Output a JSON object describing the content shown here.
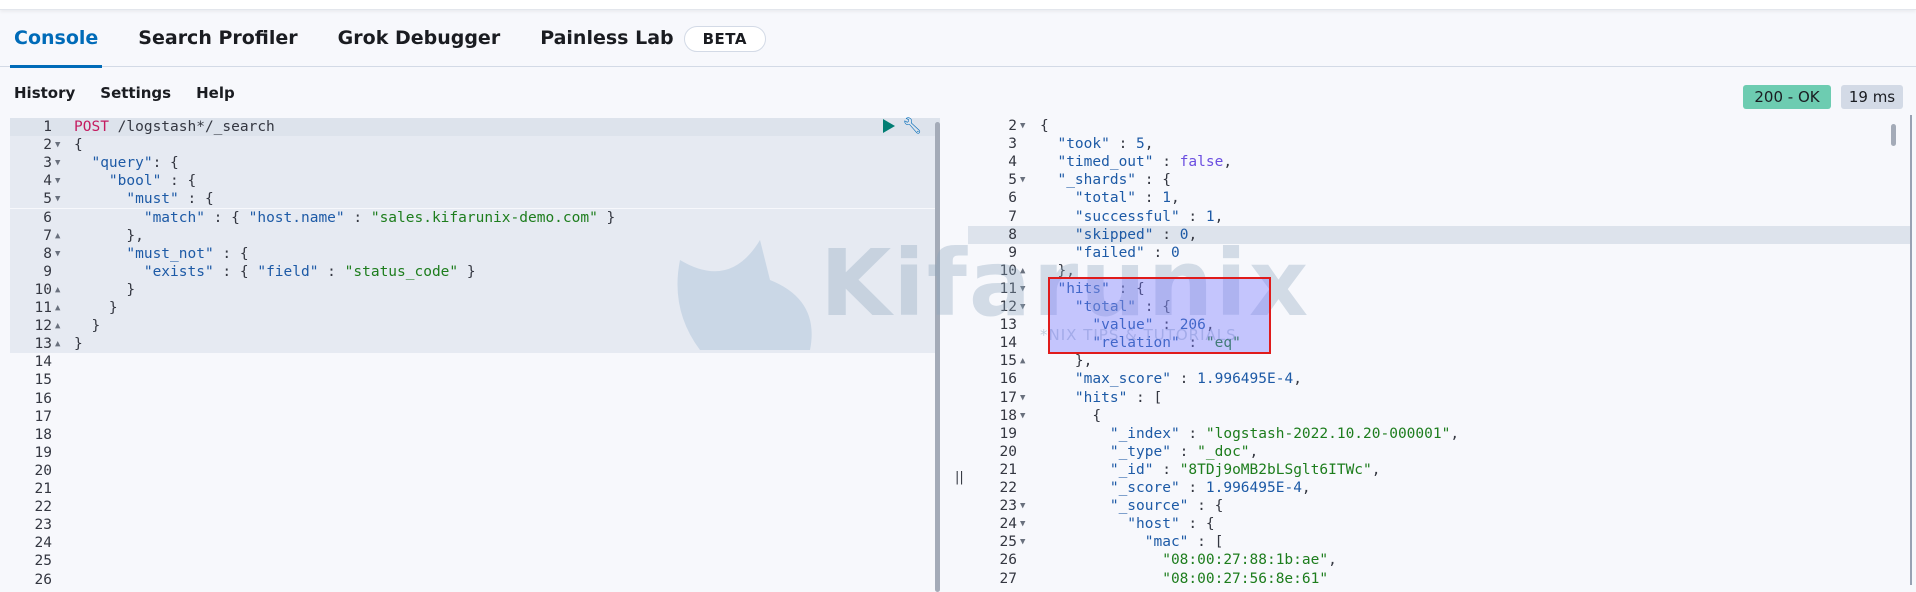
{
  "tabs": [
    {
      "label": "Console",
      "active": true
    },
    {
      "label": "Search Profiler"
    },
    {
      "label": "Grok Debugger"
    },
    {
      "label": "Painless Lab"
    }
  ],
  "beta_badge": "BETA",
  "toolbar": {
    "history": "History",
    "settings": "Settings",
    "help": "Help"
  },
  "status": {
    "code": "200 - OK",
    "time": "19 ms",
    "color": "#6dccb1"
  },
  "watermark": {
    "text": "Kifarunix",
    "subtitle": "*NIX TIPS & TUTORIALS"
  },
  "request": {
    "start": 1,
    "total_lines": 26,
    "lines": [
      {
        "f": "",
        "t": [
          [
            "m",
            "POST"
          ],
          [
            "p",
            " /logstash*/_search"
          ]
        ]
      },
      {
        "f": "down",
        "t": [
          [
            "p",
            "{"
          ]
        ]
      },
      {
        "f": "down",
        "t": [
          [
            "k",
            "  \"query\""
          ],
          [
            "p",
            ": {"
          ]
        ]
      },
      {
        "f": "down",
        "t": [
          [
            "k",
            "    \"bool\""
          ],
          [
            "p",
            " : {"
          ]
        ]
      },
      {
        "f": "down",
        "t": [
          [
            "k",
            "      \"must\""
          ],
          [
            "p",
            " : {"
          ]
        ]
      },
      {
        "f": "",
        "t": [
          [
            "k",
            "        \"match\""
          ],
          [
            "p",
            " : { "
          ],
          [
            "k",
            "\"host.name\""
          ],
          [
            "p",
            " : "
          ],
          [
            "s",
            "\"sales.kifarunix-demo.com\""
          ],
          [
            "p",
            " }"
          ]
        ]
      },
      {
        "f": "up",
        "t": [
          [
            "p",
            "      },"
          ]
        ]
      },
      {
        "f": "down",
        "t": [
          [
            "k",
            "      \"must_not\""
          ],
          [
            "p",
            " : {"
          ]
        ]
      },
      {
        "f": "",
        "t": [
          [
            "k",
            "        \"exists\""
          ],
          [
            "p",
            " : { "
          ],
          [
            "k",
            "\"field\""
          ],
          [
            "p",
            " : "
          ],
          [
            "s",
            "\"status_code\""
          ],
          [
            "p",
            " }"
          ]
        ]
      },
      {
        "f": "up",
        "t": [
          [
            "p",
            "      }"
          ]
        ]
      },
      {
        "f": "up",
        "t": [
          [
            "p",
            "    }"
          ]
        ]
      },
      {
        "f": "up",
        "t": [
          [
            "p",
            "  }"
          ]
        ]
      },
      {
        "f": "up",
        "t": [
          [
            "p",
            "}"
          ]
        ]
      }
    ]
  },
  "response": {
    "start": 2,
    "active_line": 8,
    "lines": [
      {
        "f": "down",
        "t": [
          [
            "p",
            "{"
          ]
        ]
      },
      {
        "f": "",
        "t": [
          [
            "k",
            "  \"took\""
          ],
          [
            "p",
            " : "
          ],
          [
            "n",
            "5"
          ],
          [
            "p",
            ","
          ]
        ]
      },
      {
        "f": "",
        "t": [
          [
            "k",
            "  \"timed_out\""
          ],
          [
            "p",
            " : "
          ],
          [
            "b",
            "false"
          ],
          [
            "p",
            ","
          ]
        ]
      },
      {
        "f": "down",
        "t": [
          [
            "k",
            "  \"_shards\""
          ],
          [
            "p",
            " : {"
          ]
        ]
      },
      {
        "f": "",
        "t": [
          [
            "k",
            "    \"total\""
          ],
          [
            "p",
            " : "
          ],
          [
            "n",
            "1"
          ],
          [
            "p",
            ","
          ]
        ]
      },
      {
        "f": "",
        "t": [
          [
            "k",
            "    \"successful\""
          ],
          [
            "p",
            " : "
          ],
          [
            "n",
            "1"
          ],
          [
            "p",
            ","
          ]
        ]
      },
      {
        "f": "",
        "t": [
          [
            "k",
            "    \"skipped\""
          ],
          [
            "p",
            " : "
          ],
          [
            "n",
            "0"
          ],
          [
            "p",
            ","
          ]
        ]
      },
      {
        "f": "",
        "t": [
          [
            "k",
            "    \"failed\""
          ],
          [
            "p",
            " : "
          ],
          [
            "n",
            "0"
          ]
        ]
      },
      {
        "f": "up",
        "t": [
          [
            "p",
            "  },"
          ]
        ]
      },
      {
        "f": "down",
        "t": [
          [
            "k",
            "  \"hits\""
          ],
          [
            "p",
            " : {"
          ]
        ]
      },
      {
        "f": "down",
        "t": [
          [
            "k",
            "    \"total\""
          ],
          [
            "p",
            " : {"
          ]
        ]
      },
      {
        "f": "",
        "t": [
          [
            "k",
            "      \"value\""
          ],
          [
            "p",
            " : "
          ],
          [
            "n",
            "206"
          ],
          [
            "p",
            ","
          ]
        ]
      },
      {
        "f": "",
        "t": [
          [
            "k",
            "      \"relation\""
          ],
          [
            "p",
            " : "
          ],
          [
            "s",
            "\"eq\""
          ]
        ]
      },
      {
        "f": "up",
        "t": [
          [
            "p",
            "    },"
          ]
        ]
      },
      {
        "f": "",
        "t": [
          [
            "k",
            "    \"max_score\""
          ],
          [
            "p",
            " : "
          ],
          [
            "n",
            "1.996495E-4"
          ],
          [
            "p",
            ","
          ]
        ]
      },
      {
        "f": "down",
        "t": [
          [
            "k",
            "    \"hits\""
          ],
          [
            "p",
            " : ["
          ]
        ]
      },
      {
        "f": "down",
        "t": [
          [
            "p",
            "      {"
          ]
        ]
      },
      {
        "f": "",
        "t": [
          [
            "k",
            "        \"_index\""
          ],
          [
            "p",
            " : "
          ],
          [
            "s",
            "\"logstash-2022.10.20-000001\""
          ],
          [
            "p",
            ","
          ]
        ]
      },
      {
        "f": "",
        "t": [
          [
            "k",
            "        \"_type\""
          ],
          [
            "p",
            " : "
          ],
          [
            "s",
            "\"_doc\""
          ],
          [
            "p",
            ","
          ]
        ]
      },
      {
        "f": "",
        "t": [
          [
            "k",
            "        \"_id\""
          ],
          [
            "p",
            " : "
          ],
          [
            "s",
            "\"8TDj9oMB2bLSglt6ITWc\""
          ],
          [
            "p",
            ","
          ]
        ]
      },
      {
        "f": "",
        "t": [
          [
            "k",
            "        \"_score\""
          ],
          [
            "p",
            " : "
          ],
          [
            "n",
            "1.996495E-4"
          ],
          [
            "p",
            ","
          ]
        ]
      },
      {
        "f": "down",
        "t": [
          [
            "k",
            "        \"_source\""
          ],
          [
            "p",
            " : {"
          ]
        ]
      },
      {
        "f": "down",
        "t": [
          [
            "k",
            "          \"host\""
          ],
          [
            "p",
            " : {"
          ]
        ]
      },
      {
        "f": "down",
        "t": [
          [
            "k",
            "            \"mac\""
          ],
          [
            "p",
            " : ["
          ]
        ]
      },
      {
        "f": "",
        "t": [
          [
            "s",
            "              \"08:00:27:88:1b:ae\""
          ],
          [
            "p",
            ","
          ]
        ]
      },
      {
        "f": "",
        "t": [
          [
            "s",
            "              \"08:00:27:56:8e:61\""
          ]
        ]
      }
    ]
  }
}
